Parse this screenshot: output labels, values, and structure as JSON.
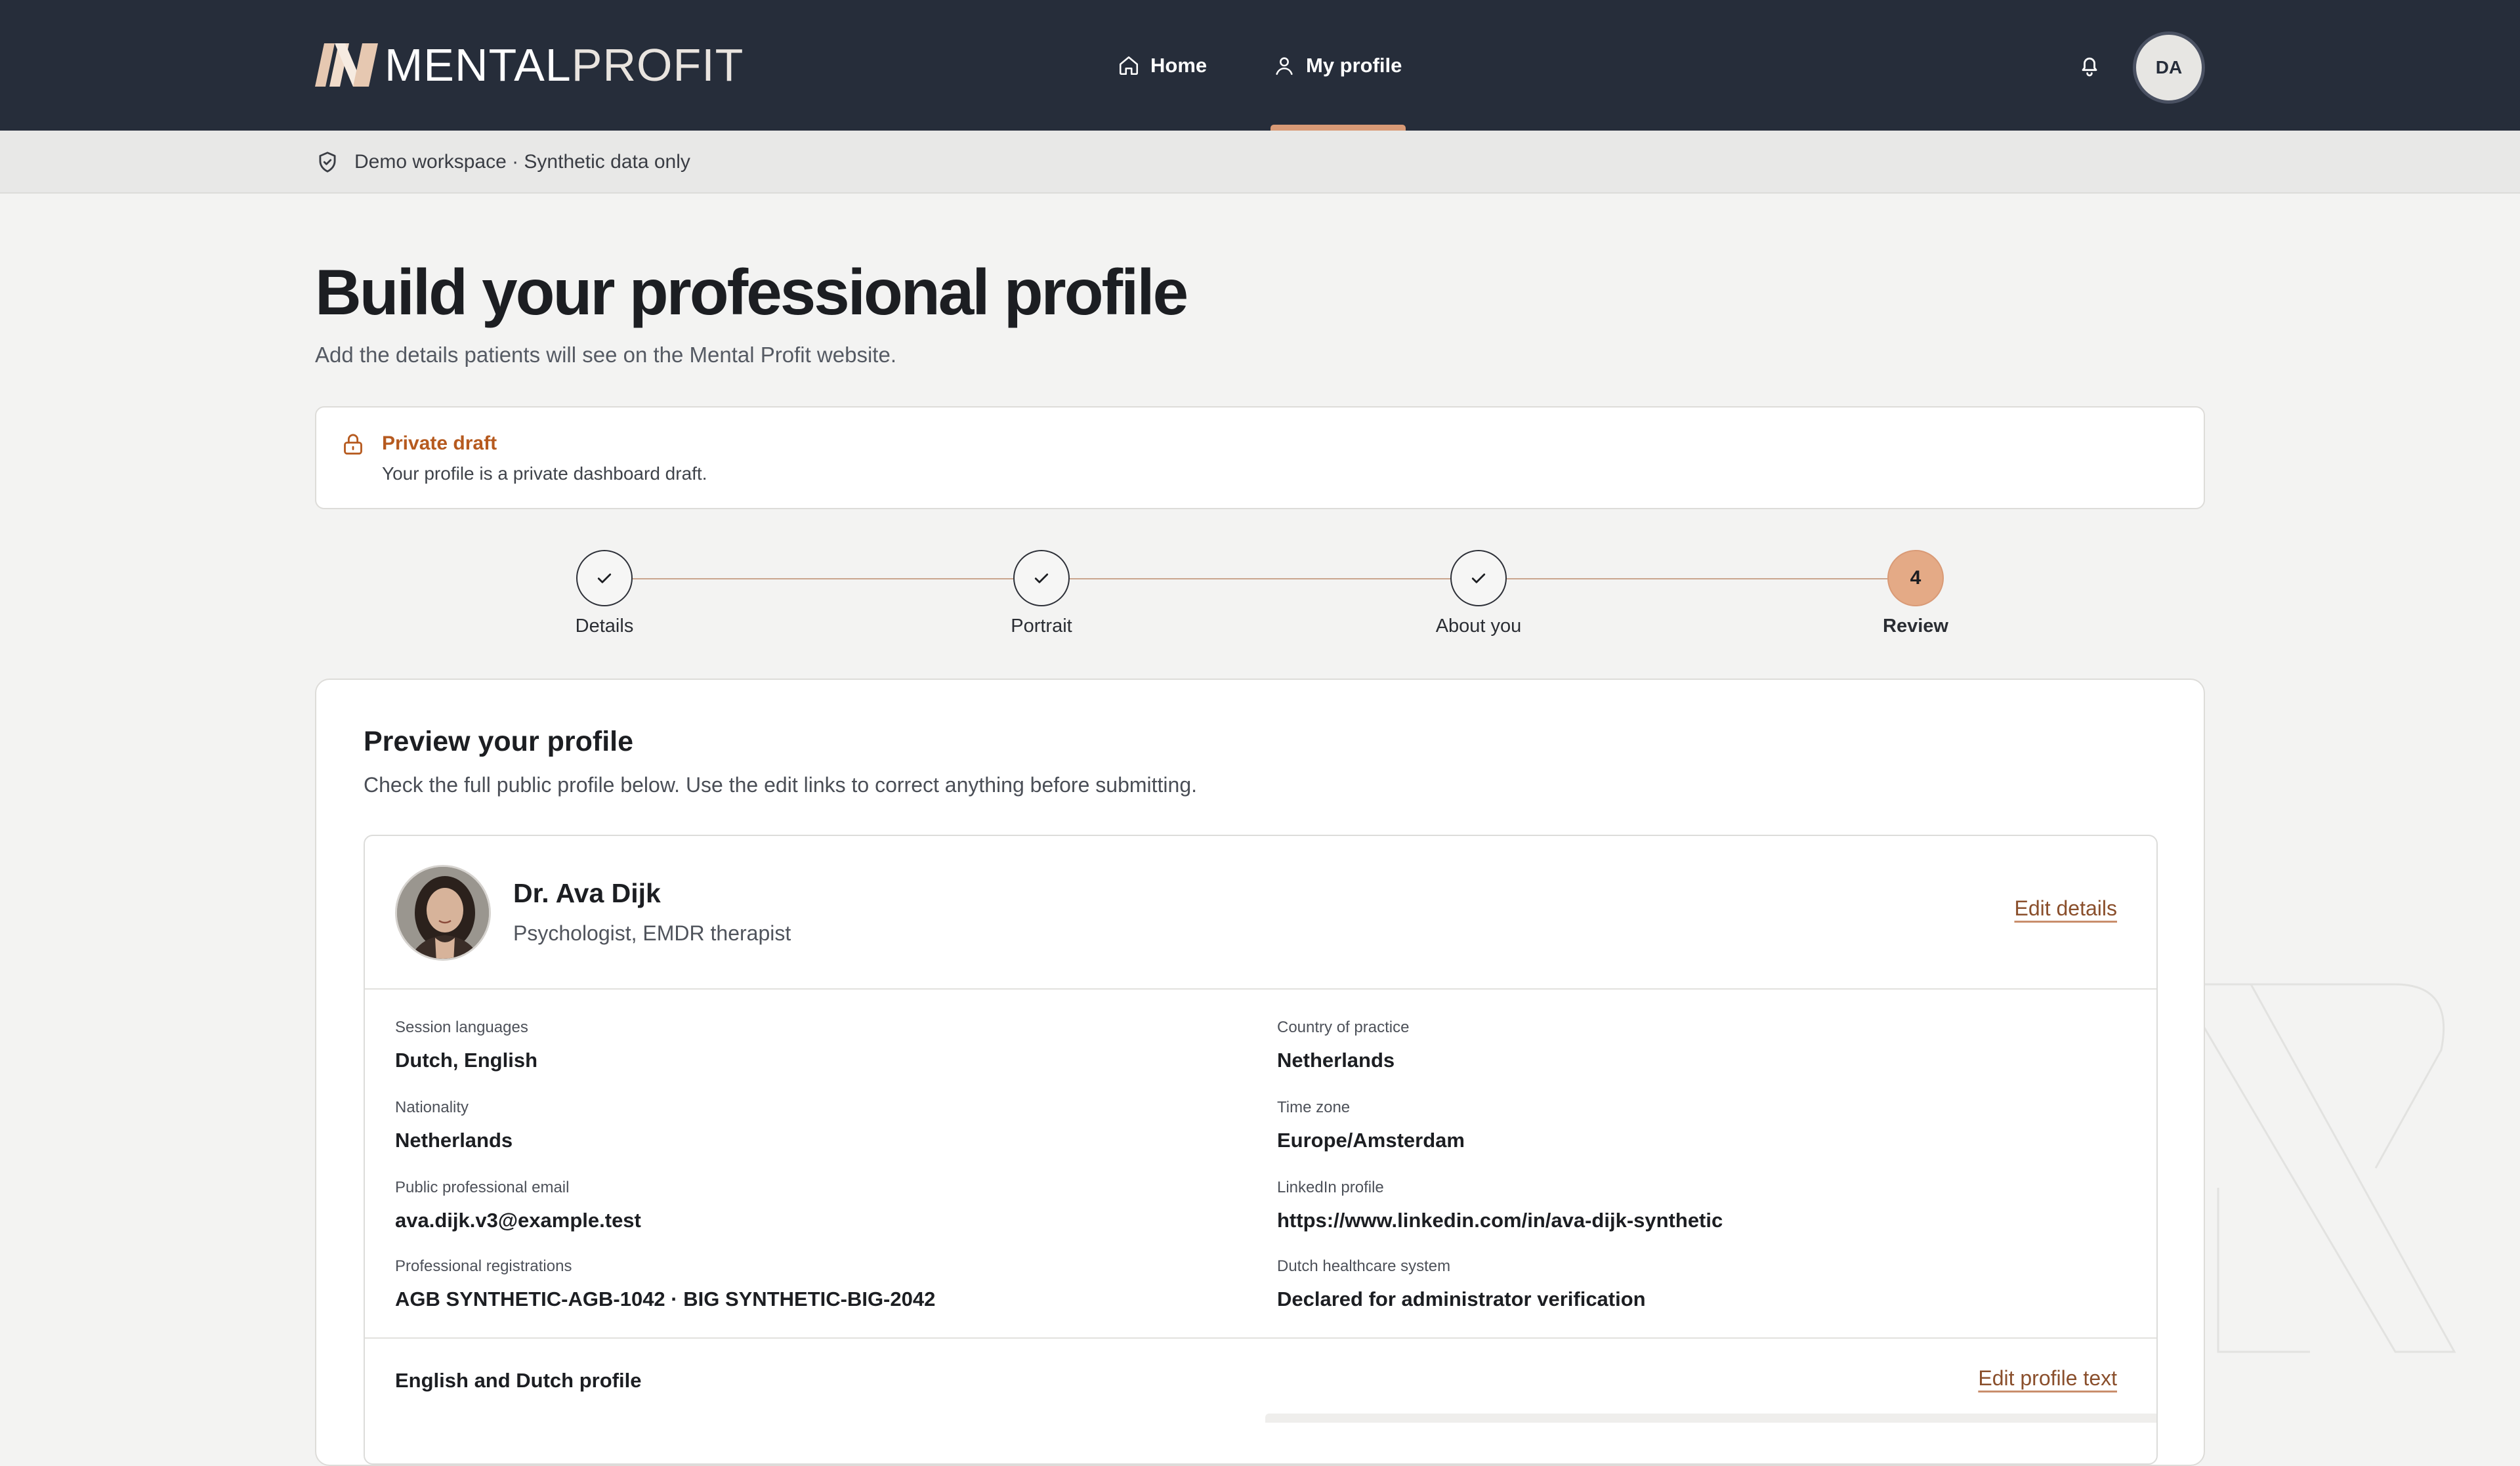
{
  "header": {
    "logo": {
      "word1": "MENTAL",
      "word2": "PROFIT"
    },
    "nav": [
      {
        "label": "Home",
        "icon": "home-icon"
      },
      {
        "label": "My profile",
        "icon": "user-icon",
        "active": true
      }
    ],
    "avatar_initials": "DA",
    "bell_icon": "bell-icon"
  },
  "demo_banner": {
    "text": "Demo workspace · Synthetic data only",
    "icon": "shield-check-icon"
  },
  "page": {
    "title": "Build your professional profile",
    "subtitle": "Add the details patients will see on the Mental Profit website."
  },
  "notice": {
    "icon": "lock-icon",
    "title": "Private draft",
    "text": "Your profile is a private dashboard draft."
  },
  "stepper": {
    "steps": [
      {
        "label": "Details",
        "state": "done"
      },
      {
        "label": "Portrait",
        "state": "done"
      },
      {
        "label": "About you",
        "state": "done"
      },
      {
        "label": "Review",
        "state": "current",
        "number": "4"
      }
    ]
  },
  "preview": {
    "title": "Preview your profile",
    "description": "Check the full public profile below. Use the edit links to correct anything before submitting.",
    "profile": {
      "name": "Dr. Ava Dijk",
      "role": "Psychologist, EMDR therapist",
      "edit_details_label": "Edit details",
      "fields_left": [
        {
          "label": "Session languages",
          "value": "Dutch, English"
        },
        {
          "label": "Nationality",
          "value": "Netherlands"
        },
        {
          "label": "Public professional email",
          "value": "ava.dijk.v3@example.test"
        },
        {
          "label": "Professional registrations",
          "value": "AGB SYNTHETIC-AGB-1042 · BIG SYNTHETIC-BIG-2042"
        }
      ],
      "fields_right": [
        {
          "label": "Country of practice",
          "value": "Netherlands"
        },
        {
          "label": "Time zone",
          "value": "Europe/Amsterdam"
        },
        {
          "label": "LinkedIn profile",
          "value": "https://www.linkedin.com/in/ava-dijk-synthetic"
        },
        {
          "label": "Dutch healthcare system",
          "value": "Declared for administrator verification"
        }
      ],
      "section_title": "English and Dutch profile",
      "edit_text_label": "Edit profile text"
    }
  },
  "colors": {
    "topbar": "#262d3a",
    "accent": "#d99a76",
    "notice_title": "#b65a1f",
    "link": "#8a4f2c",
    "page_bg": "#f3f3f2"
  }
}
